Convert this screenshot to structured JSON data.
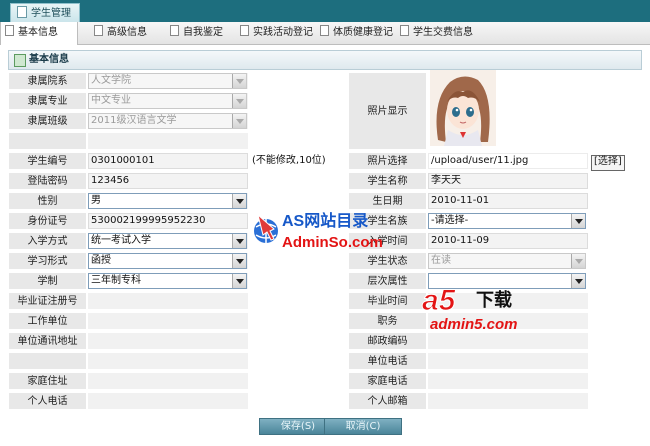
{
  "top_tab": "学生管理",
  "tabs": [
    "基本信息",
    "高级信息",
    "自我鉴定",
    "实践活动登记",
    "体质健康登记",
    "学生交费信息"
  ],
  "section_title": "基本信息",
  "left_labels": [
    "隶属院系",
    "隶属专业",
    "隶属班级",
    "学生编号",
    "登陆密码",
    "性别",
    "身份证号",
    "入学方式",
    "学习形式",
    "学制",
    "毕业证注册号",
    "工作单位",
    "单位通讯地址",
    "家庭住址",
    "个人电话"
  ],
  "right_labels": [
    "照片显示",
    "照片选择",
    "学生名称",
    "生日期",
    "学生名族",
    "入学时间",
    "学生状态",
    "层次属性",
    "毕业时间",
    "职务",
    "邮政编码",
    "单位电话",
    "家庭电话",
    "个人邮箱"
  ],
  "values": {
    "department": "人文学院",
    "major": "中文专业",
    "class": "2011级汉语言文学",
    "student_no": "0301000101",
    "student_no_note": "(不能修改,10位)",
    "password": "123456",
    "gender": "男",
    "id_card": "530002199995952230",
    "enroll_method": "统一考试入学",
    "study_form": "函授",
    "study_length": "三年制专科",
    "photo_path": "/upload/user/11.jpg",
    "choose_button": "[选择]",
    "student_name": "李天天",
    "birth_date": "2010-11-01",
    "nation": "-请选择-",
    "enroll_date": "2010-11-09",
    "status": "在读"
  },
  "buttons": {
    "save": "保存(S)",
    "cancel": "取消(C)"
  },
  "watermark1": {
    "line1": "AS网站目录",
    "line2": "AdminSo.com"
  },
  "watermark2": {
    "logo": "a5",
    "label": "下载",
    "site": "admin5.com"
  },
  "colors": {
    "topbar": "#1d6e7e",
    "label_bg": "#e8e8e8",
    "button": "#4a8599",
    "watermark_blue": "#1658c8",
    "watermark_red": "#e31414"
  }
}
